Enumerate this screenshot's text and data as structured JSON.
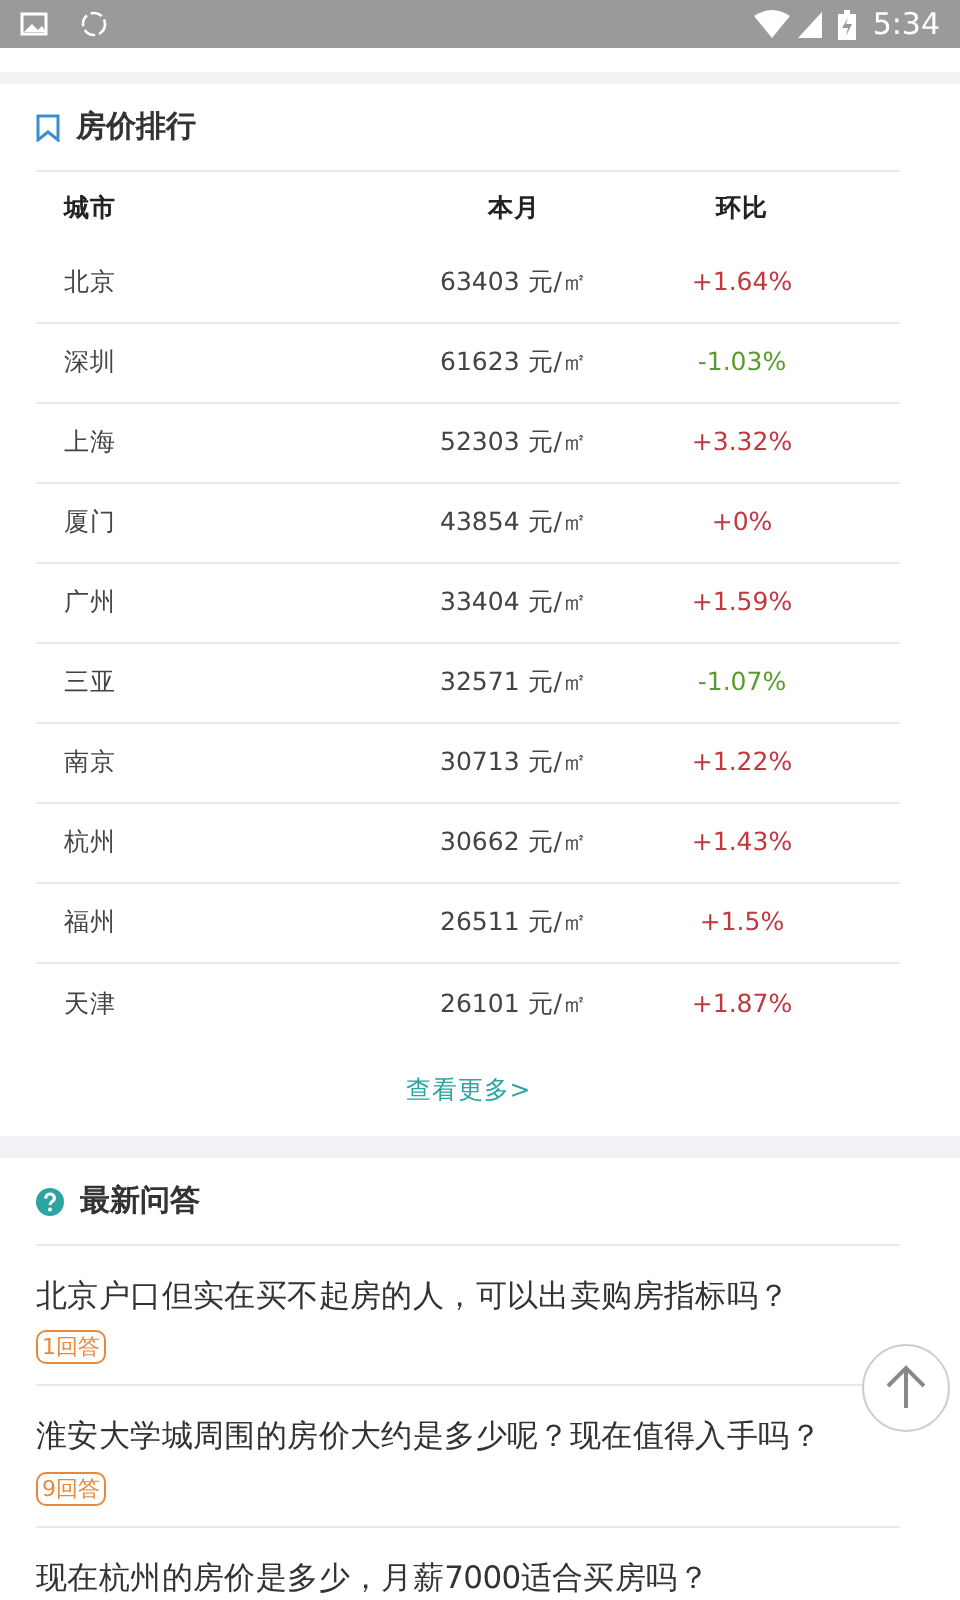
{
  "status_bar": {
    "time": "5:34"
  },
  "ranking": {
    "title": "房价排行",
    "columns": [
      "城市",
      "本月",
      "环比"
    ],
    "rows": [
      {
        "city": "北京",
        "price": "63403 元/㎡",
        "change": "+1.64%",
        "color": "#c0393f"
      },
      {
        "city": "深圳",
        "price": "61623 元/㎡",
        "change": "-1.03%",
        "color": "#5a9b2e"
      },
      {
        "city": "上海",
        "price": "52303 元/㎡",
        "change": "+3.32%",
        "color": "#c0393f"
      },
      {
        "city": "厦门",
        "price": "43854 元/㎡",
        "change": "+0%",
        "color": "#c0393f"
      },
      {
        "city": "广州",
        "price": "33404 元/㎡",
        "change": "+1.59%",
        "color": "#c0393f"
      },
      {
        "city": "三亚",
        "price": "32571 元/㎡",
        "change": "-1.07%",
        "color": "#5a9b2e"
      },
      {
        "city": "南京",
        "price": "30713 元/㎡",
        "change": "+1.22%",
        "color": "#c0393f"
      },
      {
        "city": "杭州",
        "price": "30662 元/㎡",
        "change": "+1.43%",
        "color": "#c0393f"
      },
      {
        "city": "福州",
        "price": "26511 元/㎡",
        "change": "+1.5%",
        "color": "#c0393f"
      },
      {
        "city": "天津",
        "price": "26101 元/㎡",
        "change": "+1.87%",
        "color": "#c0393f"
      }
    ],
    "more": "查看更多>"
  },
  "qa": {
    "title": "最新问答",
    "questions": [
      {
        "text": "北京户口但实在买不起房的人，可以出卖购房指标吗？",
        "answers": "1回答"
      },
      {
        "text": "淮安大学城周围的房价大约是多少呢？现在值得入手吗？",
        "answers": "9回答"
      },
      {
        "text": "现在杭州的房价是多少，月薪7000适合买房吗？"
      }
    ]
  }
}
